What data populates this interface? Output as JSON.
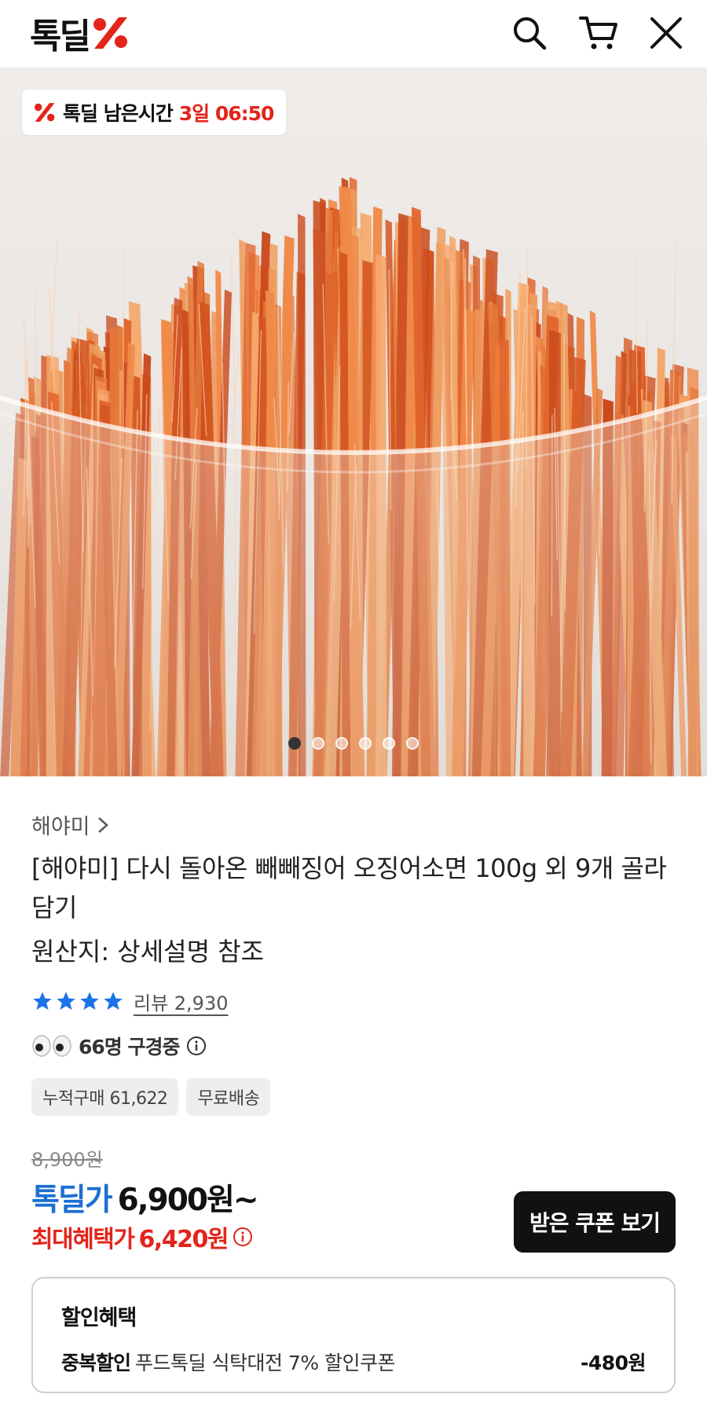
{
  "header": {
    "logo_text": "톡딜",
    "icons": [
      "search-icon",
      "cart-icon",
      "close-icon"
    ]
  },
  "hero": {
    "timer_label": "톡딜 남은시간",
    "timer_value": "3일 06:50",
    "slide_count": 6,
    "active_slide": 1
  },
  "product": {
    "brand": "해야미",
    "title": "[해야미] 다시 돌아온 빼빼징어 오징어소면 100g 외 9개 골라담기",
    "origin": "원산지: 상세설명 참조",
    "rating_stars": 4,
    "review_label": "리뷰 2,930",
    "viewers": "66명 구경중",
    "tags": [
      "누적구매 61,622",
      "무료배송"
    ]
  },
  "price": {
    "original": "8,900원",
    "deal_label": "톡딜가",
    "deal_price": "6,900원~",
    "max_label": "최대혜택가",
    "max_price": "6,420원",
    "coupon_button": "받은 쿠폰 보기"
  },
  "discount": {
    "title": "할인혜택",
    "type": "중복할인",
    "description": "푸드톡딜 식탁대전 7% 할인쿠폰",
    "amount": "-480원"
  },
  "colors": {
    "accent_blue": "#1b6fd1",
    "accent_red": "#e3241a",
    "star_blue": "#1a73e8"
  }
}
